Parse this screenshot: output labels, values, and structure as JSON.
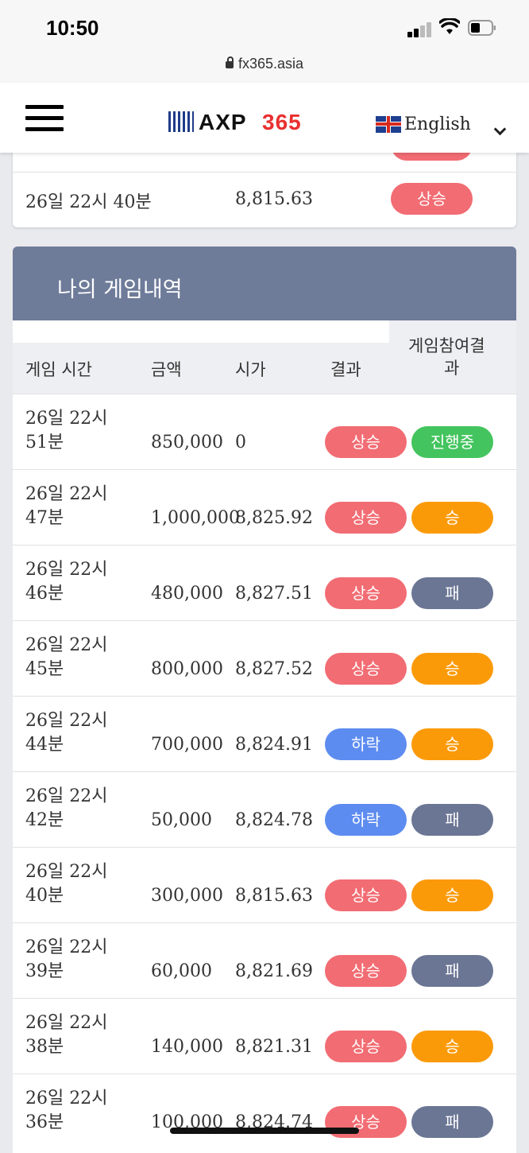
{
  "status_bar": {
    "time": "10:50",
    "url": "fx365.asia"
  },
  "header": {
    "logo_left": "AXP",
    "logo_right": "365",
    "language": "English"
  },
  "top_card": {
    "date": "26일 22시 40분",
    "price": "8,815.63",
    "result": "상승"
  },
  "history": {
    "title": "나의 게임내역",
    "columns": {
      "time": "게임 시간",
      "amount": "금액",
      "open": "시가",
      "result": "결과",
      "participation_line1": "게임참여결",
      "participation_line2": "과"
    },
    "rows": [
      {
        "date1": "26일 22시",
        "date2": "51분",
        "amount": "850,000",
        "open": "0",
        "result": "상승",
        "result_color": "#f26c73",
        "outcome": "진행중",
        "outcome_color": "#43c45e"
      },
      {
        "date1": "26일 22시",
        "date2": "47분",
        "amount": "1,000,000",
        "open": "8,825.92",
        "result": "상승",
        "result_color": "#f26c73",
        "outcome": "승",
        "outcome_color": "#fb9a09"
      },
      {
        "date1": "26일 22시",
        "date2": "46분",
        "amount": "480,000",
        "open": "8,827.51",
        "result": "상승",
        "result_color": "#f26c73",
        "outcome": "패",
        "outcome_color": "#6b7694"
      },
      {
        "date1": "26일 22시",
        "date2": "45분",
        "amount": "800,000",
        "open": "8,827.52",
        "result": "상승",
        "result_color": "#f26c73",
        "outcome": "승",
        "outcome_color": "#fb9a09"
      },
      {
        "date1": "26일 22시",
        "date2": "44분",
        "amount": "700,000",
        "open": "8,824.91",
        "result": "하락",
        "result_color": "#5d8cf0",
        "outcome": "승",
        "outcome_color": "#fb9a09"
      },
      {
        "date1": "26일 22시",
        "date2": "42분",
        "amount": "50,000",
        "open": "8,824.78",
        "result": "하락",
        "result_color": "#5d8cf0",
        "outcome": "패",
        "outcome_color": "#6b7694"
      },
      {
        "date1": "26일 22시",
        "date2": "40분",
        "amount": "300,000",
        "open": "8,815.63",
        "result": "상승",
        "result_color": "#f26c73",
        "outcome": "승",
        "outcome_color": "#fb9a09"
      },
      {
        "date1": "26일 22시",
        "date2": "39분",
        "amount": "60,000",
        "open": "8,821.69",
        "result": "상승",
        "result_color": "#f26c73",
        "outcome": "패",
        "outcome_color": "#6b7694"
      },
      {
        "date1": "26일 22시",
        "date2": "38분",
        "amount": "140,000",
        "open": "8,821.31",
        "result": "상승",
        "result_color": "#f26c73",
        "outcome": "승",
        "outcome_color": "#fb9a09"
      },
      {
        "date1": "26일 22시",
        "date2": "36분",
        "amount": "100,000",
        "open": "8,824.74",
        "result": "상승",
        "result_color": "#f26c73",
        "outcome": "패",
        "outcome_color": "#6b7694"
      }
    ]
  }
}
